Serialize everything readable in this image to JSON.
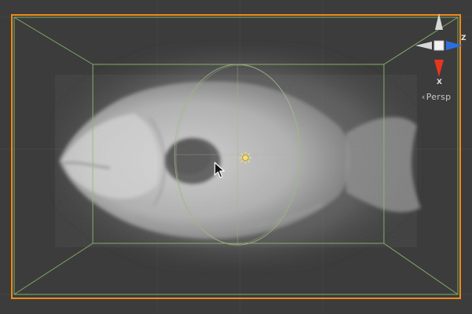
{
  "viewport": {
    "view_mode_label": "Persp",
    "axis_labels": {
      "x": "X",
      "z": "Z"
    },
    "colors": {
      "background": "#3f3f3f",
      "selection_outline": "#f08a1a",
      "volume_box": "#8fbf6a",
      "gizmo_x": "#e8351e",
      "gizmo_z": "#2a6fe0",
      "gizmo_neutral": "#d8d8d8",
      "light_icon": "#f5e070"
    },
    "icons": [
      "cursor-arrow-icon",
      "directional-light-icon",
      "orientation-gizmo-icon"
    ]
  }
}
